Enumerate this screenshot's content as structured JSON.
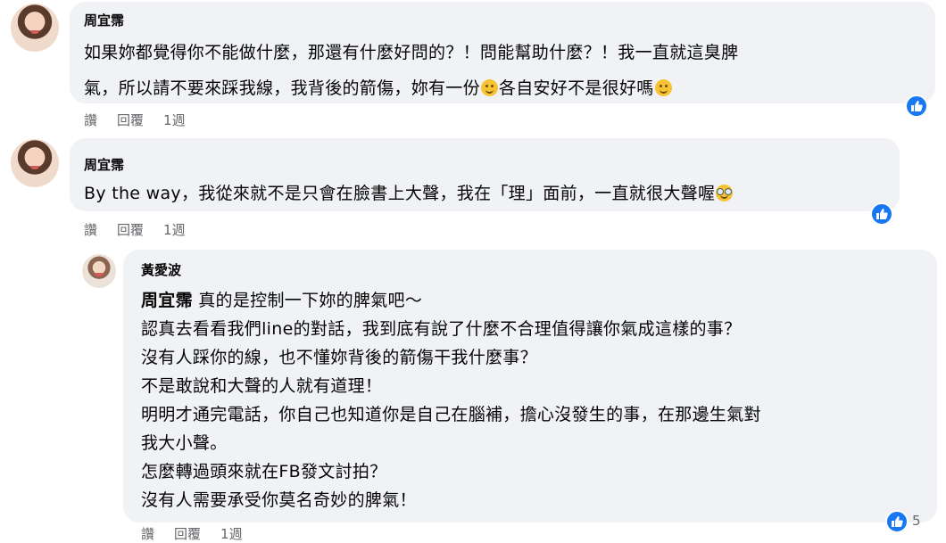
{
  "comments": [
    {
      "author": "周宜霈",
      "lines": [
        [
          "如果妳都覺得你不能做什麼，那還有什麼好問的？！問能幫助什麼？！我一直就這臭脾"
        ],
        [
          "氣，所以請不要來踩我線，我背後的箭傷，妳有一份",
          "各自安好不是很好嗎"
        ]
      ],
      "actions": [
        "讚",
        "回覆",
        "1週"
      ]
    },
    {
      "author": "周宜霈",
      "lines": [
        [
          "By the way，我從來就不是只會在臉書上大聲，我在「理」面前，一直就很大聲喔"
        ]
      ],
      "actions": [
        "讚",
        "回覆",
        "1週"
      ]
    },
    {
      "author": "黃愛波",
      "mention": "周宜霈",
      "first_line_rest": " 真的是控制一下妳的脾氣吧～",
      "lines": [
        "認真去看看我們line的對話，我到底有說了什麼不合理值得讓你氣成這樣的事？",
        "沒有人踩你的線，也不懂妳背後的箭傷干我什麼事？",
        "不是敢說和大聲的人就有道理！",
        "明明才通完電話，你自己也知道你是自己在腦補，擔心沒發生的事，在那邊生氣對",
        "我大小聲。",
        "怎麼轉過頭來就在FB發文討拍？",
        "沒有人需要承受你莫名奇妙的脾氣！"
      ],
      "like_count": "5",
      "actions": [
        "讚",
        "回覆",
        "1週"
      ]
    }
  ]
}
